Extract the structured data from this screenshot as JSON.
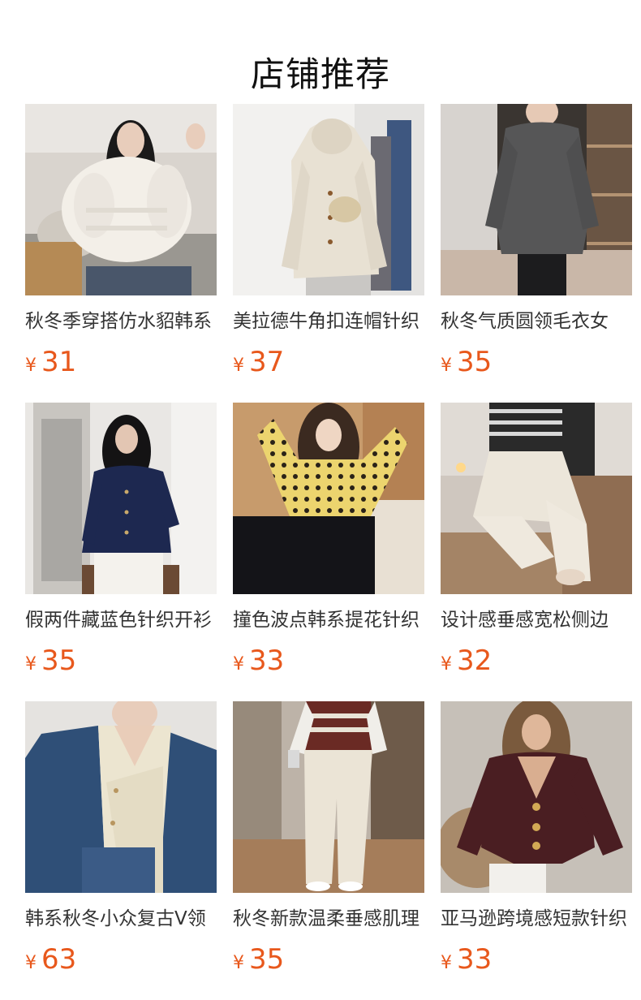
{
  "header": {
    "title": "店铺推荐"
  },
  "colors": {
    "price": "#e8581c",
    "title": "#333333",
    "heading": "#111111"
  },
  "products": [
    {
      "title": "秋冬季穿搭仿水貂韩系",
      "currency": "¥",
      "price": "31",
      "image": "white-faux-fur-cardigan-photo"
    },
    {
      "title": "美拉德牛角扣连帽针织",
      "currency": "¥",
      "price": "37",
      "image": "cream-cable-knit-hooded-cardigan-photo"
    },
    {
      "title": "秋冬气质圆领毛衣女",
      "currency": "¥",
      "price": "35",
      "image": "charcoal-crewneck-sweater-photo"
    },
    {
      "title": "假两件藏蓝色针织开衫",
      "currency": "¥",
      "price": "35",
      "image": "navy-knit-cardigan-photo"
    },
    {
      "title": "撞色波点韩系提花针织",
      "currency": "¥",
      "price": "33",
      "image": "yellow-polka-dot-cardigan-photo"
    },
    {
      "title": "设计感垂感宽松侧边",
      "currency": "¥",
      "price": "32",
      "image": "cream-ribbed-wide-leg-pants-photo"
    },
    {
      "title": "韩系秋冬小众复古V领",
      "currency": "¥",
      "price": "63",
      "image": "denim-knit-patchwork-cardigan-photo"
    },
    {
      "title": "秋冬新款温柔垂感肌理",
      "currency": "¥",
      "price": "35",
      "image": "cream-corduroy-wide-pants-photo"
    },
    {
      "title": "亚马逊跨境感短款针织",
      "currency": "¥",
      "price": "33",
      "image": "burgundy-vneck-short-cardigan-photo"
    }
  ]
}
